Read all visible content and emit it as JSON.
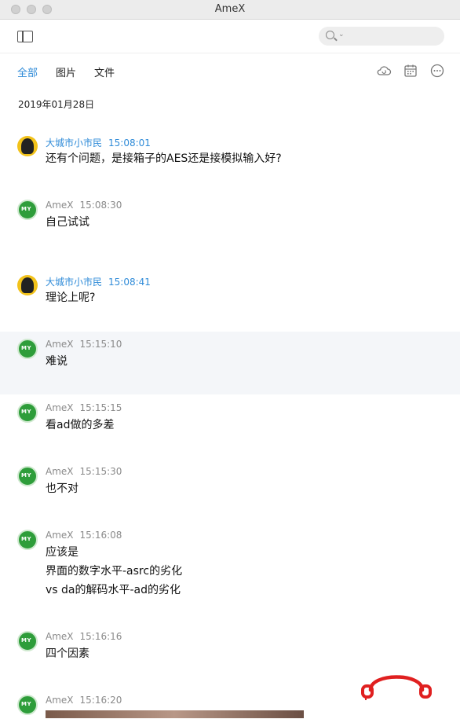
{
  "window": {
    "title": "AmeX"
  },
  "toolbar": {
    "sidebar_icon": "sidebar-icon",
    "search_placeholder": ""
  },
  "tabs": [
    {
      "label": "全部",
      "active": true
    },
    {
      "label": "图片",
      "active": false
    },
    {
      "label": "文件",
      "active": false
    }
  ],
  "toolbar_icons": [
    "cloud-sync-icon",
    "calendar-icon",
    "more-icon"
  ],
  "date": "2019年01月28日",
  "messages": [
    {
      "sender": "大城市小市民",
      "time": "15:08:01",
      "lines": [
        "还有个问题，是接箱子的AES还是接模拟输入好?"
      ]
    },
    {
      "sender": "AmeX",
      "time": "15:08:30",
      "lines": [
        "自己试试"
      ]
    },
    {
      "sender": "大城市小市民",
      "time": "15:08:41",
      "lines": [
        "理论上呢?"
      ]
    },
    {
      "sender": "AmeX",
      "time": "15:15:10",
      "lines": [
        "难说"
      ]
    },
    {
      "sender": "AmeX",
      "time": "15:15:15",
      "lines": [
        "看ad做的多差"
      ]
    },
    {
      "sender": "AmeX",
      "time": "15:15:30",
      "lines": [
        "也不对"
      ]
    },
    {
      "sender": "AmeX",
      "time": "15:16:08",
      "lines": [
        "应该是",
        "界面的数字水平-asrc的劣化",
        "vs da的解码水平-ad的劣化"
      ]
    },
    {
      "sender": "AmeX",
      "time": "15:16:16",
      "lines": [
        "四个因素"
      ]
    },
    {
      "sender": "AmeX",
      "time": "15:16:20",
      "lines": []
    }
  ],
  "colors": {
    "accent": "#2f8bd8",
    "logo": "#e02020"
  }
}
